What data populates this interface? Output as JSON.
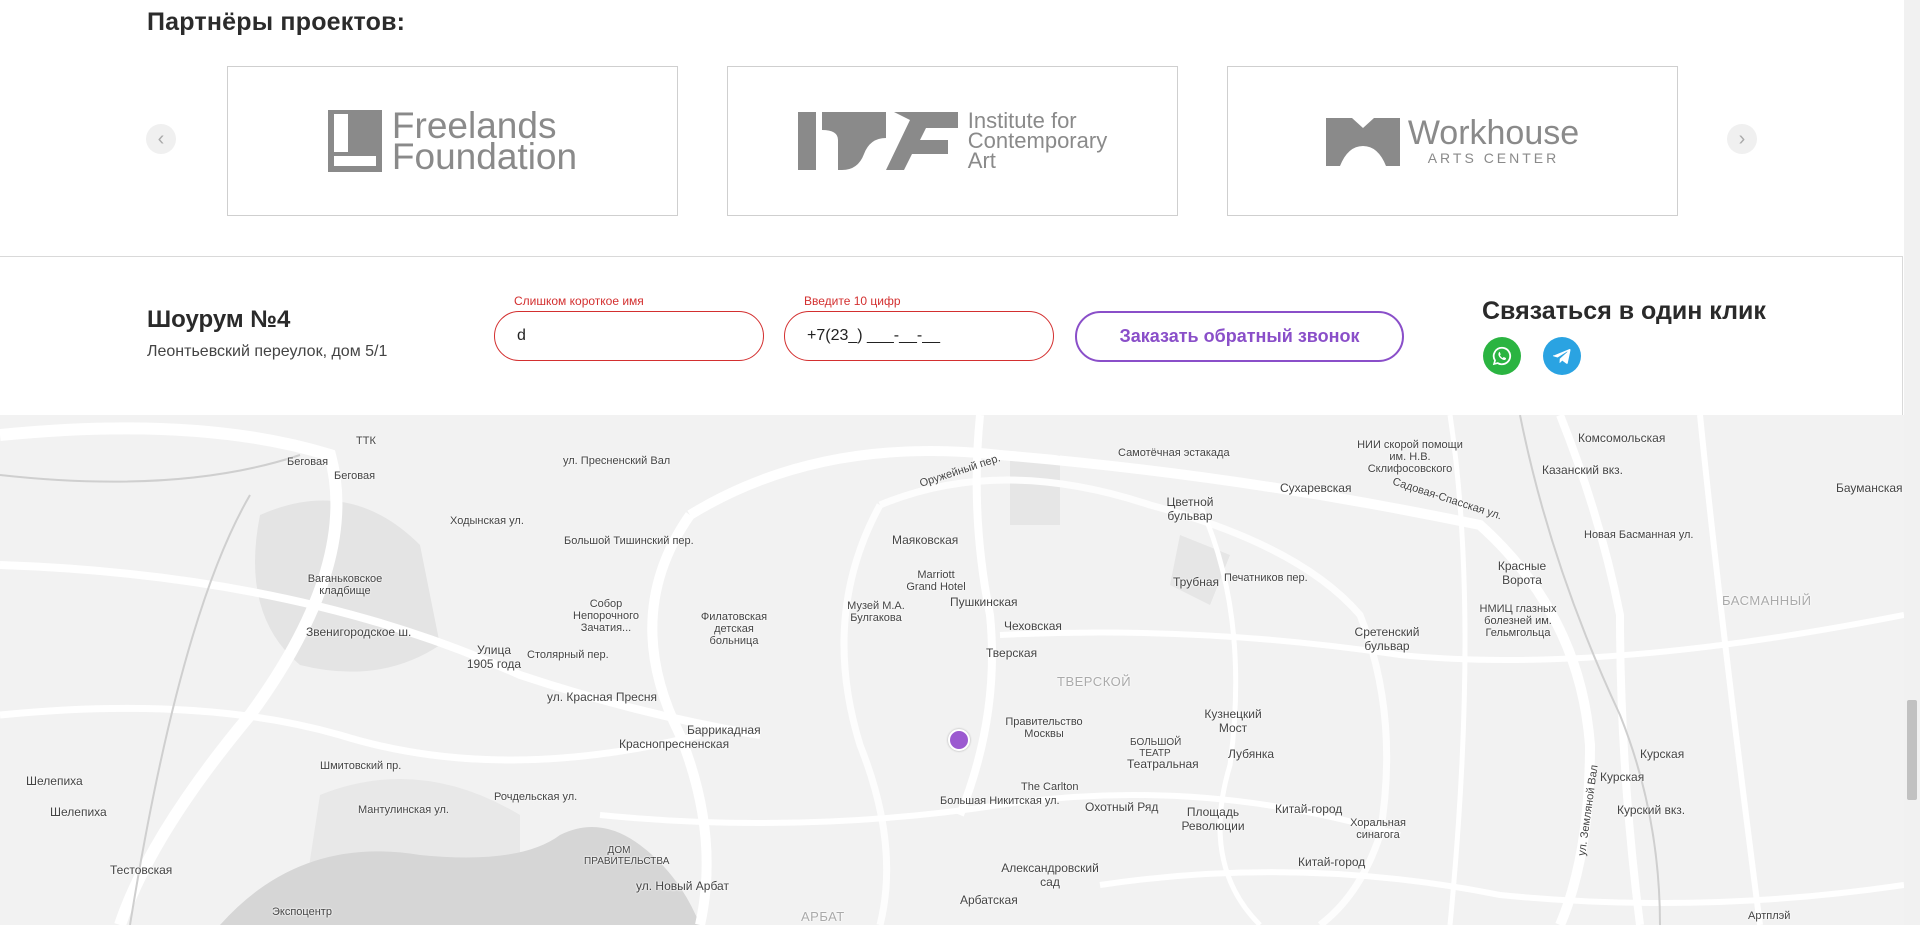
{
  "partners": {
    "title": "Партнёры проектов:",
    "prev_arrow": "‹",
    "next_arrow": "›",
    "cards": [
      {
        "line1": "Freelands",
        "line2": "Foundation"
      },
      {
        "line1": "Institute for",
        "line2": "Contemporary",
        "line3": "Art"
      },
      {
        "line1": "Workhouse",
        "line2": "ARTS CENTER"
      }
    ]
  },
  "contact": {
    "showroom_title": "Шоурум №4",
    "showroom_address": "Леонтьевский переулок, дом 5/1",
    "name_error": "Слишком короткое имя",
    "name_value": "d",
    "phone_error": "Введите 10 цифр",
    "phone_value": "+7(23_) ___-__-__",
    "cta_label": "Заказать обратный звонок",
    "oneclick_title": "Связаться в один клик",
    "whatsapp_icon": "whatsapp-icon",
    "telegram_icon": "telegram-icon"
  },
  "map": {
    "labels": [
      "Беговая",
      "Беговая",
      "ТТК",
      "Ходынская ул.",
      "ул. Пресненский Вал",
      "Большой Тишинский пер.",
      "Ваганьковское кладбище",
      "Звенигородское ш.",
      "Улица 1905 года",
      "Столярный пер.",
      "Собор Непорочного Зачатия...",
      "Филатовская детская больница",
      "Музей М.А. Булгакова",
      "Маяковская",
      "Marriott Grand Hotel",
      "Пушкинская",
      "Чеховская",
      "Тверская",
      "ТВЕРСКОЙ",
      "Правительство Москвы",
      "ул. Красная Пресня",
      "Баррикадная",
      "Краснопресненская",
      "Шелепиха",
      "Шелепиха",
      "Шмитовский пр.",
      "Мантулинская ул.",
      "Рочдельская ул.",
      "Большая Никитская ул.",
      "The Carlton",
      "Охотный Ряд",
      "Площадь Революции",
      "Китай-город",
      "Китай-город",
      "Театральная",
      "БОЛЬШОЙ ТЕАТР",
      "Кузнецкий Мост",
      "Лубянка",
      "Трубная",
      "Цветной бульвар",
      "Сухаревская",
      "НИИ скорой помощи им. Н.В. Склифосовского",
      "Самотёчная эстакада",
      "Садовая-Спасская ул.",
      "Комсомольская",
      "Казанский вкз.",
      "Бауманская",
      "Красные Ворота",
      "НМИЦ глазных болезней им. Гельмгольца",
      "Сретенский бульвар",
      "БАСМАННЫЙ",
      "Курская",
      "Курская",
      "Курский вкз.",
      "Хоральная синагога",
      "Александровский сад",
      "Арбатская",
      "ДОМ ПРАВИТЕЛЬСТВА",
      "ул. Новый Арбат",
      "Тестовская",
      "Экспоцентр",
      "АРБАТ",
      "Печатников пер.",
      "Оружейный пер.",
      "Новая Басманная ул.",
      "ул. Земляной Вал",
      "Артплэй"
    ]
  }
}
